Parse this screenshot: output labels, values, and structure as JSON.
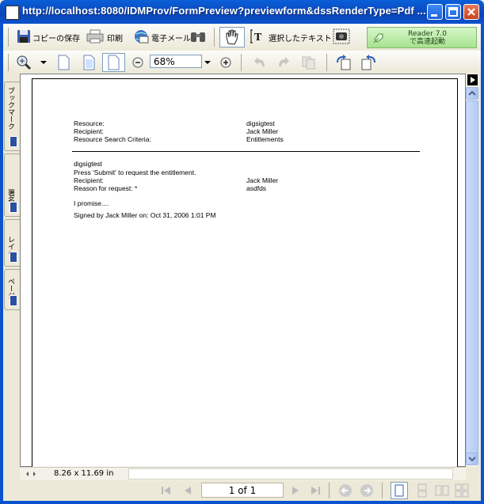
{
  "window": {
    "title": "http://localhost:8080/IDMProv/FormPreview?previewform&dssRenderType=Pdf ..."
  },
  "toolbar": {
    "copy_save_label": "コピーの保存",
    "print_label": "印刷",
    "email_label": "電子メール",
    "select_text_label": "選択したテキスト",
    "reader_line1": "Reader 7.0",
    "reader_line2": "で高速起動",
    "zoom_value": "68%"
  },
  "side_tabs": {
    "bookmarks": "ブックマーク",
    "signatures": "署名",
    "layers": "レイヤ",
    "pages": "ページ"
  },
  "document": {
    "resource_label": "Resource:",
    "resource_value": "digsigtest",
    "recipient_label": "Recipient:",
    "recipient_value": "Jack Miller",
    "search_criteria_label": "Resource Search Criteria:",
    "search_criteria_value": "Entitlements",
    "section_title": "digsigtest",
    "instruction": "Press 'Submit' to request the entitlement.",
    "recipient2_label": "Recipient:",
    "recipient2_value": "Jack Miller",
    "reason_label": "Reason for request: *",
    "reason_value": "asdfds",
    "promise": "I promise....",
    "signed_by": "Signed by Jack Miller on: Oct 31, 2006 1:01 PM"
  },
  "statusbar": {
    "page_size": "8.26 x 11.69 in",
    "page_indicator": "1 of 1"
  }
}
